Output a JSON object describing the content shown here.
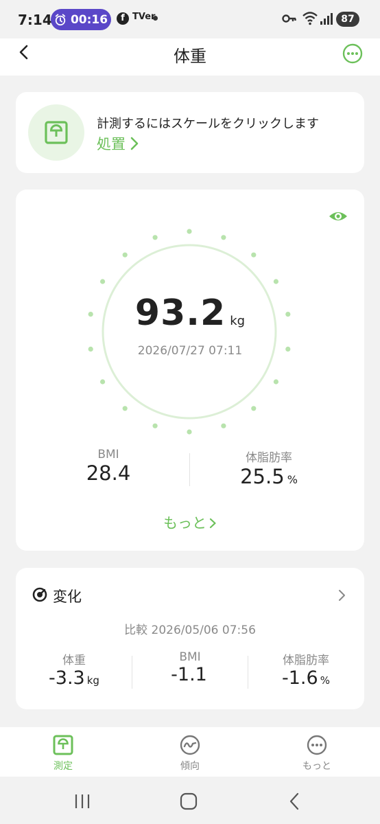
{
  "status_bar": {
    "time": "7:14",
    "alarm_timer": "00:16",
    "facebook_glyph": "f",
    "tver_label": "TVer",
    "battery": "87"
  },
  "header": {
    "title": "体重"
  },
  "tip": {
    "message": "計測するにはスケールをクリックします",
    "action_label": "処置"
  },
  "weight": {
    "value": "93.2",
    "unit": "kg",
    "datetime": "2026/07/27 07:11",
    "bmi_label": "BMI",
    "bmi_value": "28.4",
    "fat_label": "体脂肪率",
    "fat_value": "25.5",
    "fat_unit": "%",
    "more_label": "もっと"
  },
  "change": {
    "title": "変化",
    "compare_line": "比較 2026/05/06 07:56",
    "items": [
      {
        "label": "体重",
        "value": "-3.3",
        "unit": "kg"
      },
      {
        "label": "BMI",
        "value": "-1.1",
        "unit": ""
      },
      {
        "label": "体脂肪率",
        "value": "-1.6",
        "unit": "%"
      }
    ]
  },
  "tabbar": {
    "tabs": [
      {
        "label": "測定",
        "active": true
      },
      {
        "label": "傾向",
        "active": false
      },
      {
        "label": "もっと",
        "active": false
      }
    ]
  },
  "colors": {
    "accent": "#6cc05a",
    "accent_light": "#e9f5e5",
    "background": "#f2f2f2",
    "alarm_pill": "#5a47c8"
  }
}
